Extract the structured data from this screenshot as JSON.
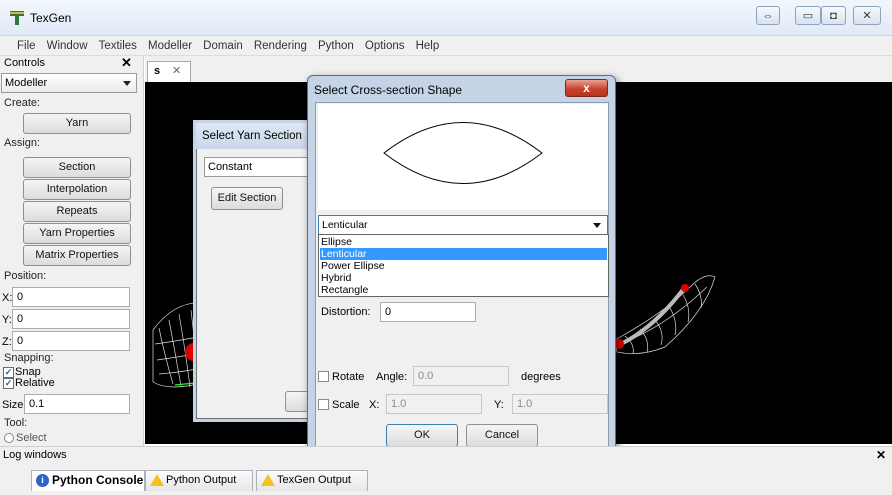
{
  "window": {
    "title": "TexGen",
    "snap_glyph": "⇔",
    "min_glyph": "▭",
    "max_glyph": "◘",
    "close_glyph": "✕"
  },
  "menu": [
    "File",
    "Window",
    "Textiles",
    "Modeller",
    "Domain",
    "Rendering",
    "Python",
    "Options",
    "Help"
  ],
  "controls": {
    "title": "Controls",
    "close": "✕",
    "mode": "Modeller",
    "create_label": "Create:",
    "yarn_button": "Yarn",
    "assign_label": "Assign:",
    "section_button": "Section",
    "interpolation_button": "Interpolation",
    "repeats_button": "Repeats",
    "yarn_properties_button": "Yarn Properties",
    "matrix_properties_button": "Matrix Properties",
    "position_label": "Position:",
    "x_label": "X:",
    "x_value": "0",
    "y_label": "Y:",
    "y_value": "0",
    "z_label": "Z:",
    "z_value": "0",
    "snapping_label": "Snapping:",
    "snap_label": "Snap",
    "relative_label": "Relative",
    "check_glyph": "✓",
    "size_label": "Size:",
    "size_value": "0.1",
    "tool_label": "Tool:",
    "select_label": "Select"
  },
  "document_tab": {
    "label": "s",
    "close": "✕"
  },
  "yarn_dialog": {
    "title": "Select Yarn Section",
    "mode": "Constant",
    "edit_button": "Edit Section"
  },
  "cs_dialog": {
    "title": "Select Cross-section Shape",
    "close": "x",
    "selected_shape": "Lenticular",
    "options": [
      "Ellipse",
      "Lenticular",
      "Power Ellipse",
      "Hybrid",
      "Rectangle"
    ],
    "selected_index": 1,
    "distortion_label": "Distortion:",
    "distortion_value": "0",
    "rotate_label": "Rotate",
    "angle_label": "Angle:",
    "angle_value": "0.0",
    "degrees_label": "degrees",
    "scale_label": "Scale",
    "scale_x_label": "X:",
    "scale_x_value": "1.0",
    "scale_y_label": "Y:",
    "scale_y_value": "1.0",
    "ok_button": "OK",
    "cancel_button": "Cancel"
  },
  "log": {
    "title": "Log windows",
    "close": "✕",
    "tabs": [
      "Python Console",
      "Python Output",
      "TexGen Output"
    ],
    "info_glyph": "i",
    "warn_glyph": "!"
  },
  "colors": {
    "accent": "#3399ff",
    "viewport": "#000000",
    "marker_red": "#ff0000"
  }
}
